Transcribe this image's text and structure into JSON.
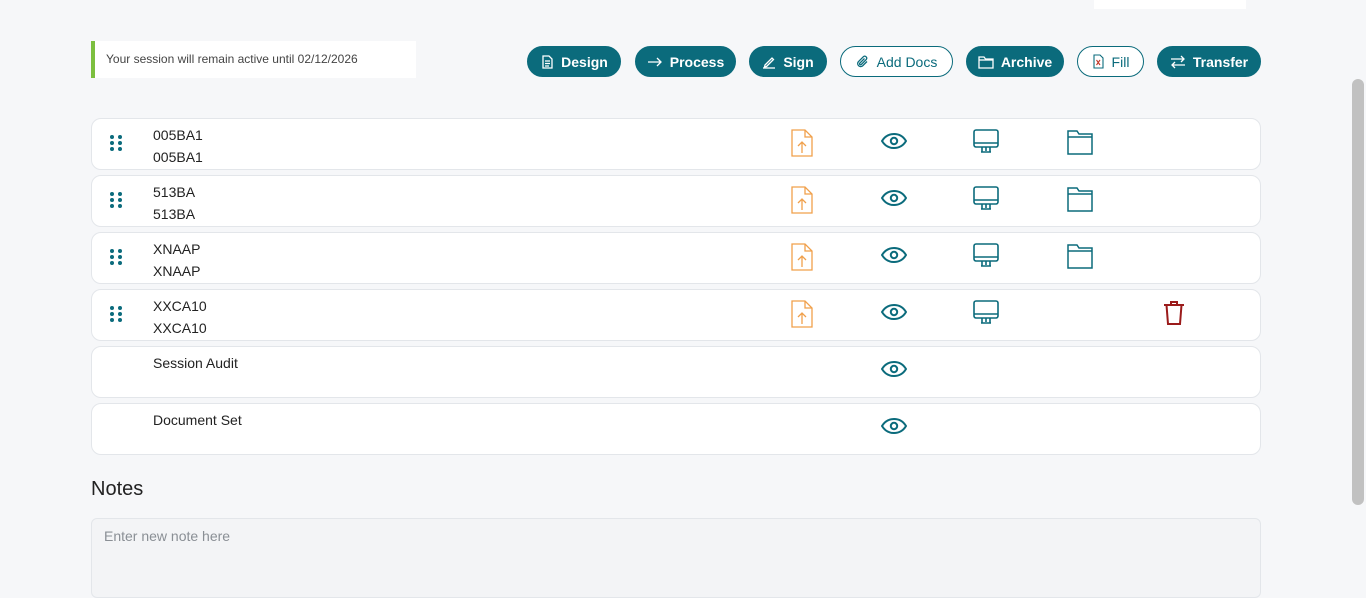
{
  "session": {
    "banner": "Your session will remain active until 02/12/2026"
  },
  "toolbar": {
    "buttons": [
      {
        "label": "Design",
        "icon": "document-icon",
        "style": "solid"
      },
      {
        "label": "Process",
        "icon": "arrow-right-icon",
        "style": "solid"
      },
      {
        "label": "Sign",
        "icon": "pen-icon",
        "style": "solid"
      },
      {
        "label": "Add Docs",
        "icon": "paperclip-icon",
        "style": "outline"
      },
      {
        "label": "Archive",
        "icon": "folder-icon",
        "style": "solid"
      },
      {
        "label": "Fill",
        "icon": "excel-file-icon",
        "style": "outline"
      },
      {
        "label": "Transfer",
        "icon": "swap-arrows-icon",
        "style": "solid"
      }
    ]
  },
  "documents": [
    {
      "title": "005BA1",
      "subtitle": "005BA1",
      "draggable": true,
      "actions": [
        "upload",
        "view",
        "desktop",
        "folder"
      ]
    },
    {
      "title": "513BA",
      "subtitle": "513BA",
      "draggable": true,
      "actions": [
        "upload",
        "view",
        "desktop",
        "folder"
      ]
    },
    {
      "title": "XNAAP",
      "subtitle": "XNAAP",
      "draggable": true,
      "actions": [
        "upload",
        "view",
        "desktop",
        "folder"
      ]
    },
    {
      "title": "XXCA10",
      "subtitle": "XXCA10",
      "draggable": true,
      "actions": [
        "upload",
        "view",
        "desktop",
        "delete"
      ]
    },
    {
      "title": "Session Audit",
      "subtitle": "",
      "draggable": false,
      "actions": [
        "view"
      ]
    },
    {
      "title": "Document Set",
      "subtitle": "",
      "draggable": false,
      "actions": [
        "view"
      ]
    }
  ],
  "notes": {
    "title": "Notes",
    "placeholder": "Enter new note here",
    "value": ""
  },
  "colors": {
    "primary": "#0b6b7c",
    "accent_green": "#7cbf3f",
    "upload_orange": "#f0a04b",
    "delete_red": "#9b1b1b"
  }
}
